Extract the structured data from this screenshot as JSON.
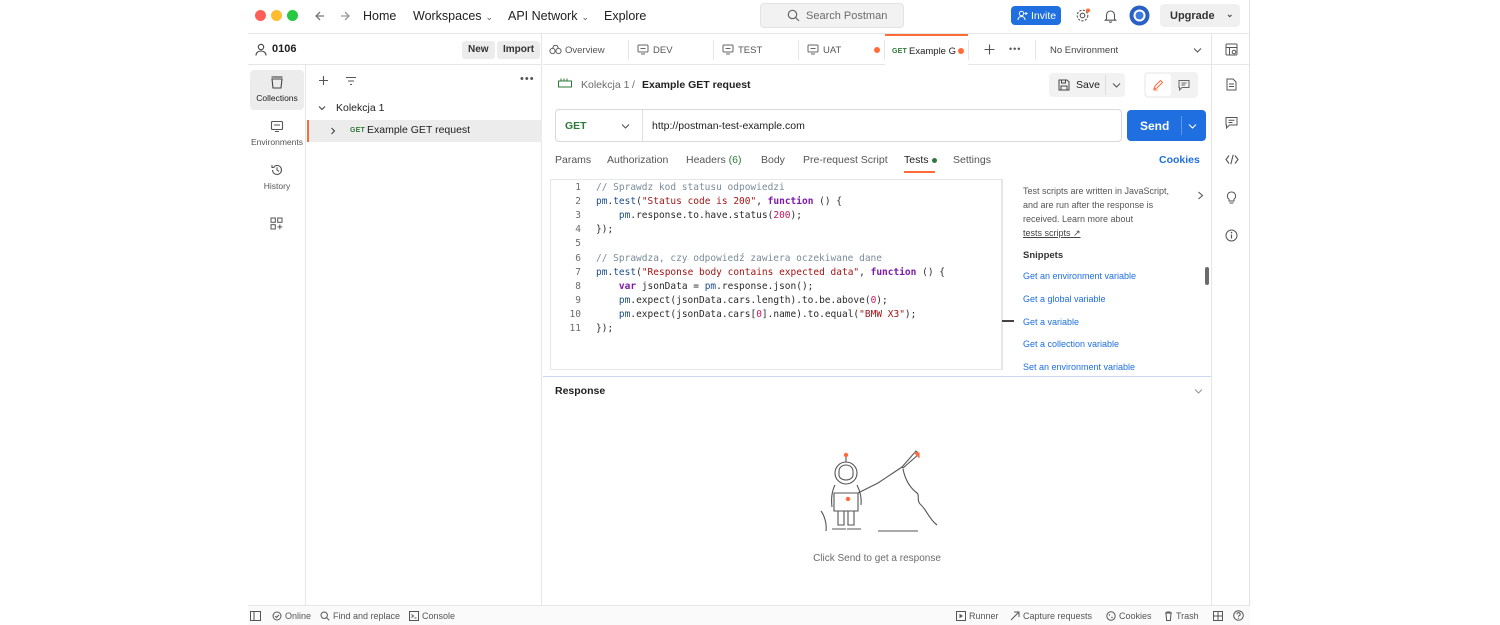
{
  "window": {
    "traffic_lights": [
      "#ff5f57",
      "#febc2e",
      "#28c840"
    ]
  },
  "topbar": {
    "home": "Home",
    "workspaces": "Workspaces",
    "api_network": "API Network",
    "explore": "Explore",
    "search_placeholder": "Search Postman",
    "invite": "Invite",
    "upgrade": "Upgrade"
  },
  "workspace": {
    "name": "0106",
    "new_label": "New",
    "import_label": "Import"
  },
  "rail": {
    "items": [
      {
        "label": "Collections",
        "icon": "collections-icon",
        "active": true
      },
      {
        "label": "Environments",
        "icon": "environments-icon"
      },
      {
        "label": "History",
        "icon": "history-icon"
      },
      {
        "label": "",
        "icon": "apps-icon"
      }
    ]
  },
  "sidebar": {
    "collection": "Kolekcja 1",
    "request_method": "GET",
    "request_name": "Example GET request"
  },
  "tabs": [
    {
      "label": "Overview",
      "icon": "overview-icon"
    },
    {
      "label": "DEV",
      "icon": "environment-icon"
    },
    {
      "label": "TEST",
      "icon": "environment-icon"
    },
    {
      "label": "UAT",
      "icon": "environment-icon",
      "unsaved": true
    },
    {
      "label": "Example G",
      "method": "GET",
      "unsaved": true,
      "active": true
    }
  ],
  "environment_selector": "No Environment",
  "request": {
    "breadcrumb_collection": "Kolekcja 1",
    "breadcrumb_separator": "/",
    "title": "Example GET request",
    "save_label": "Save",
    "method": "GET",
    "url": "http://postman-test-example.com",
    "send_label": "Send",
    "cookies_label": "Cookies"
  },
  "subtabs": [
    {
      "label": "Params"
    },
    {
      "label": "Authorization"
    },
    {
      "label": "Headers",
      "count": "(6)"
    },
    {
      "label": "Body"
    },
    {
      "label": "Pre-request Script"
    },
    {
      "label": "Tests",
      "active": true
    },
    {
      "label": "Settings"
    }
  ],
  "code_lines": [
    {
      "n": "1",
      "html": "<span class='cm'>// Sprawdz kod statusu odpowiedzi</span>"
    },
    {
      "n": "2",
      "html": "<span class='fn'>pm</span>.<span class='fn'>test</span>(<span class='str'>\"Status code is 200\"</span>, <span class='kw'>function</span> () {"
    },
    {
      "n": "3",
      "html": "    <span class='fn'>pm</span>.response.to.have.status(<span class='num'>200</span>);"
    },
    {
      "n": "4",
      "html": "});"
    },
    {
      "n": "5",
      "html": ""
    },
    {
      "n": "6",
      "html": "<span class='cm'>// Sprawdza, czy odpowiedź zawiera oczekiwane dane</span>"
    },
    {
      "n": "7",
      "html": "<span class='fn'>pm</span>.<span class='fn'>test</span>(<span class='str'>\"Response body contains expected data\"</span>, <span class='kw'>function</span> () {"
    },
    {
      "n": "8",
      "html": "    <span class='kw'>var</span> jsonData = <span class='fn'>pm</span>.response.json();"
    },
    {
      "n": "9",
      "html": "    <span class='fn'>pm</span>.expect(jsonData.cars.length).to.be.above(<span class='num'>0</span>);"
    },
    {
      "n": "10",
      "html": "    <span class='fn'>pm</span>.expect(jsonData.cars[<span class='num'>0</span>].name).to.equal(<span class='str'>\"BMW X3\"</span>);"
    },
    {
      "n": "11",
      "html": "});"
    }
  ],
  "snippets_panel": {
    "intro_1": "Test scripts are written in JavaScript,",
    "intro_2": "and are run after the response is",
    "intro_3": "received. Learn more about",
    "link": "tests scripts ↗",
    "heading": "Snippets",
    "items": [
      "Get an environment variable",
      "Get a global variable",
      "Get a variable",
      "Get a collection variable",
      "Set an environment variable"
    ]
  },
  "response": {
    "heading": "Response",
    "empty_text": "Click Send to get a response"
  },
  "footer": {
    "online": "Online",
    "find_replace": "Find and replace",
    "console": "Console",
    "runner": "Runner",
    "capture": "Capture requests",
    "cookies": "Cookies",
    "trash": "Trash"
  },
  "colors": {
    "accent": "#ff6c37",
    "primary": "#1f6fe0"
  }
}
